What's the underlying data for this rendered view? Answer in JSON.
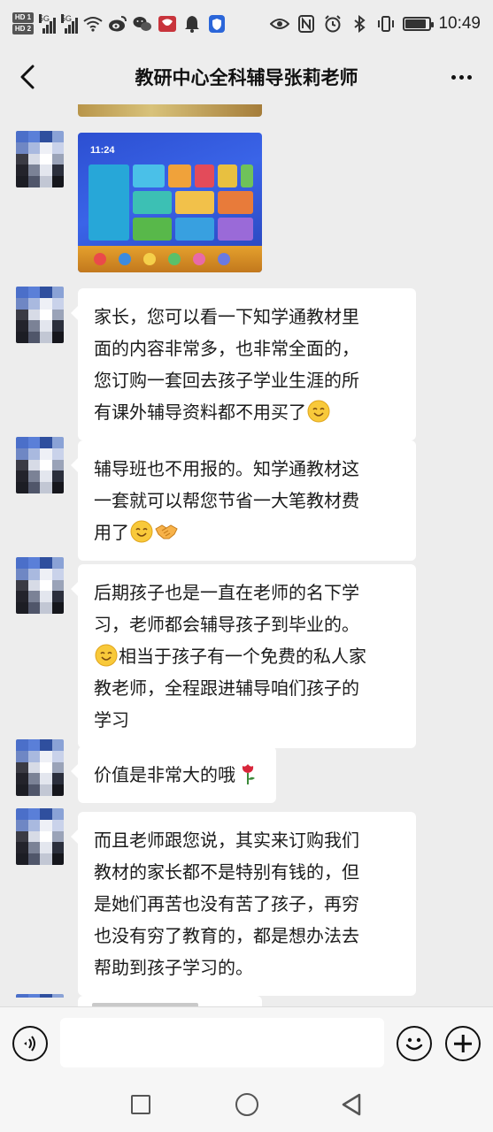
{
  "status_bar": {
    "hd1": "HD 1",
    "hd2": "HD 2",
    "net1": "5G",
    "net2": "5G",
    "time": "10:49",
    "battery_level": 0.85,
    "icons": [
      "signal-icon",
      "wifi-icon",
      "weibo-icon",
      "wechat-icon",
      "app-icon",
      "bell-icon",
      "shield-icon",
      "eye-icon",
      "nfc-icon",
      "alarm-icon",
      "bluetooth-icon",
      "vibrate-icon",
      "battery-icon"
    ]
  },
  "header": {
    "title": "教研中心全科辅导张莉老师",
    "back_icon": "chevron-left-icon",
    "more_icon": "more-dots-icon"
  },
  "tablet_image": {
    "time": "11:24"
  },
  "messages": [
    {
      "type": "text",
      "lines": [
        "家长，您可以看一下知学通教材里",
        "面的内容非常多，也非常全面的，",
        "您订购一套回去孩子学业生涯的所",
        "有课外辅导资料都不用买了"
      ],
      "emoji": [
        "smile"
      ]
    },
    {
      "type": "text",
      "lines": [
        "辅导班也不用报的。知学通教材这",
        "一套就可以帮您节省一大笔教材费",
        "用了"
      ],
      "emoji": [
        "smile",
        "handshake"
      ]
    },
    {
      "type": "text",
      "lines": [
        "后期孩子也是一直在老师的名下学",
        "习，老师都会辅导孩子到毕业的。",
        "相当于孩子有一个免费的私人家",
        "教老师，全程跟进辅导咱们孩子的",
        "学习"
      ],
      "emoji": [
        "smile"
      ]
    },
    {
      "type": "text",
      "lines": [
        "价值是非常大的哦"
      ],
      "emoji": [
        "rose"
      ]
    },
    {
      "type": "text",
      "lines": [
        "而且老师跟您说，其实来订购我们",
        "教材的家长都不是特别有钱的，但",
        "是她们再苦也没有苦了孩子，再穷",
        "也没有穷了教育的，都是想办法去",
        "帮助到孩子学习的。"
      ]
    }
  ],
  "input_bar": {
    "placeholder": "",
    "voice_icon": "voice-icon",
    "emoji_icon": "emoji-icon",
    "add_icon": "plus-icon"
  },
  "nav_bar": {
    "recent_icon": "recent-apps-icon",
    "home_icon": "home-icon",
    "back_icon": "back-triangle-icon"
  }
}
